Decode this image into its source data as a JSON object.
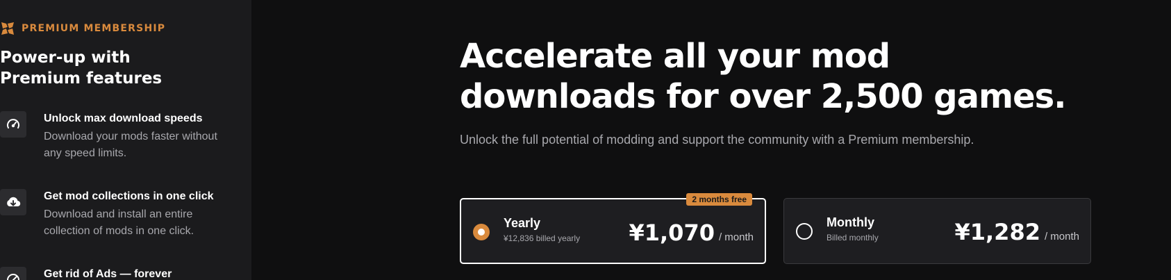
{
  "sidebar": {
    "brand": {
      "label": "PREMIUM MEMBERSHIP",
      "icon": "nexus-logo-icon",
      "color": "#d98a3d"
    },
    "title": "Power-up with Premium features",
    "features": [
      {
        "icon": "speedometer-icon",
        "title": "Unlock max download speeds",
        "desc": "Download your mods faster without any speed limits."
      },
      {
        "icon": "cloud-download-icon",
        "title": "Get mod collections in one click",
        "desc": "Download and install an entire collection of mods in one click."
      },
      {
        "icon": "no-ads-icon",
        "title": "Get rid of Ads — forever",
        "desc": ""
      }
    ]
  },
  "main": {
    "headline": "Accelerate all your mod downloads for over 2,500 games.",
    "subhead": "Unlock the full potential of modding and support the community with a Premium membership.",
    "plans": [
      {
        "name": "Yearly",
        "billing": "¥12,836 billed yearly",
        "price": "¥1,070",
        "unit": "/ month",
        "badge": "2 months free",
        "selected": true
      },
      {
        "name": "Monthly",
        "billing": "Billed monthly",
        "price": "¥1,282",
        "unit": "/ month",
        "selected": false
      }
    ]
  },
  "colors": {
    "accent": "#d98a3d",
    "background": "#0f0f10",
    "sidebar": "#1b1b1d"
  }
}
